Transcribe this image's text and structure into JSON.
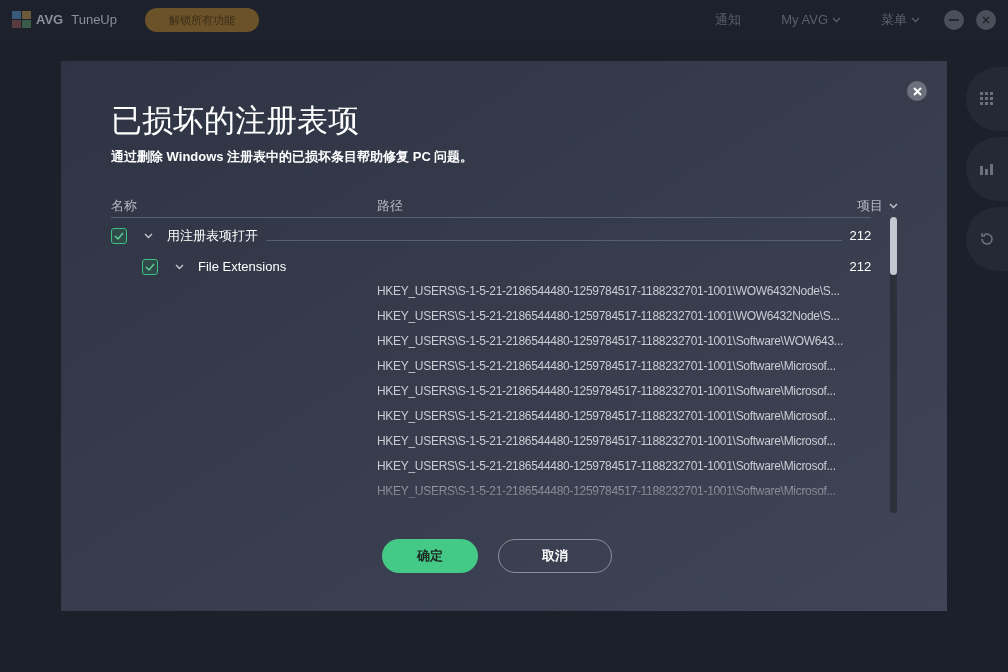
{
  "topbar": {
    "brand": "AVG",
    "product": "TuneUp",
    "unlock_button": "解锁所有功能",
    "nav": [
      {
        "label": "通知",
        "has_caret": false
      },
      {
        "label": "My AVG",
        "has_caret": true
      },
      {
        "label": "菜单",
        "has_caret": true
      }
    ]
  },
  "dialog": {
    "title": "已损坏的注册表项",
    "subtitle": "通过删除 Windows 注册表中的已损坏条目帮助修复 PC 问题。",
    "columns": {
      "name": "名称",
      "path": "路径",
      "items": "项目"
    },
    "tree": [
      {
        "label": "用注册表项打开",
        "count": "212",
        "checked": true,
        "expanded": true,
        "children": [
          {
            "label": "File Extensions",
            "count": "212",
            "checked": true,
            "expanded": true,
            "paths": [
              "HKEY_USERS\\S-1-5-21-2186544480-1259784517-1188232701-1001\\WOW6432Node\\S...",
              "HKEY_USERS\\S-1-5-21-2186544480-1259784517-1188232701-1001\\WOW6432Node\\S...",
              "HKEY_USERS\\S-1-5-21-2186544480-1259784517-1188232701-1001\\Software\\WOW643...",
              "HKEY_USERS\\S-1-5-21-2186544480-1259784517-1188232701-1001\\Software\\Microsof...",
              "HKEY_USERS\\S-1-5-21-2186544480-1259784517-1188232701-1001\\Software\\Microsof...",
              "HKEY_USERS\\S-1-5-21-2186544480-1259784517-1188232701-1001\\Software\\Microsof...",
              "HKEY_USERS\\S-1-5-21-2186544480-1259784517-1188232701-1001\\Software\\Microsof...",
              "HKEY_USERS\\S-1-5-21-2186544480-1259784517-1188232701-1001\\Software\\Microsof...",
              "HKEY_USERS\\S-1-5-21-2186544480-1259784517-1188232701-1001\\Software\\Microsof..."
            ]
          }
        ]
      }
    ],
    "buttons": [
      {
        "label": "确定",
        "kind": "primary"
      },
      {
        "label": "取消",
        "kind": "secondary"
      }
    ]
  }
}
